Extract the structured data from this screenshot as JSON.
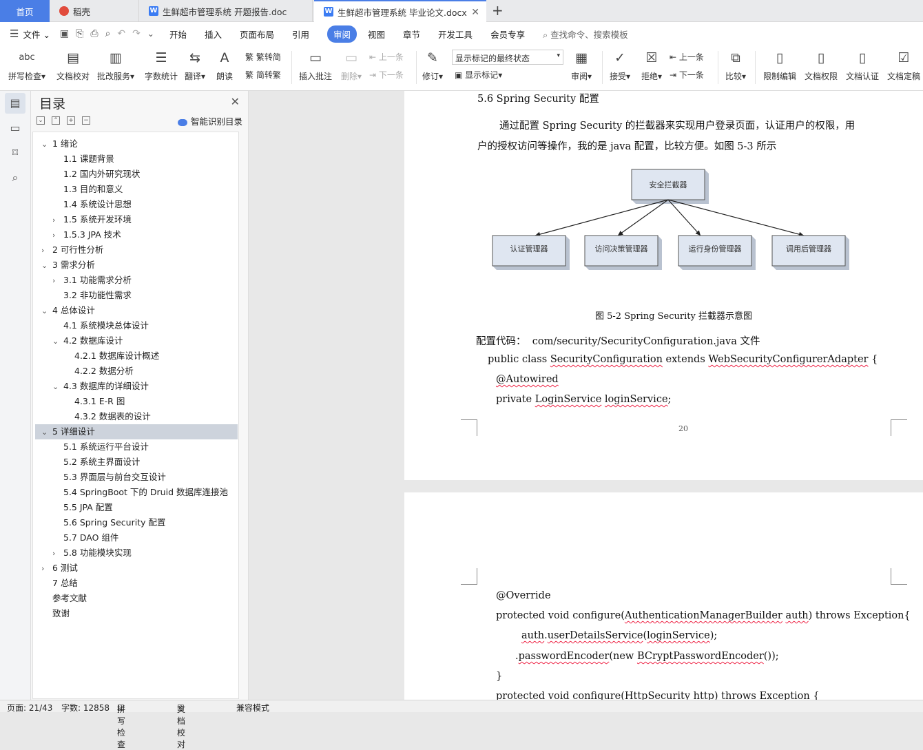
{
  "tabs": {
    "home": "首页",
    "t1": "稻壳",
    "t2": "生鲜超市管理系统 开题报告.doc",
    "t3": "生鲜超市管理系统 毕业论文.docx"
  },
  "menu": {
    "file": "文件",
    "items": [
      "开始",
      "插入",
      "页面布局",
      "引用",
      "审阅",
      "视图",
      "章节",
      "开发工具",
      "会员专享"
    ],
    "search": "查找命令、搜索模板"
  },
  "toolbar": {
    "spell": "拼写检查",
    "proof": "文档校对",
    "batch": "批改服务",
    "wordcount": "字数统计",
    "translate": "翻译",
    "read": "朗读",
    "t2s": "繁转简",
    "s2t": "简转繁",
    "insert_comment": "插入批注",
    "delete": "删除",
    "prev_comment": "上一条",
    "next_comment": "下一条",
    "revise": "修订",
    "dropdown": "显示标记的最终状态",
    "show_marks": "显示标记",
    "review": "审阅",
    "accept": "接受",
    "reject": "拒绝",
    "prev": "上一条",
    "next": "下一条",
    "compare": "比较",
    "restrict": "限制编辑",
    "perm": "文档权限",
    "cert": "文档认证",
    "final": "文档定稿"
  },
  "toc": {
    "title": "目录",
    "smart": "智能识别目录",
    "items": [
      {
        "text": "1 绪论",
        "level": 0,
        "arrow": "v"
      },
      {
        "text": "1.1 课题背景",
        "level": 1,
        "arrow": ""
      },
      {
        "text": "1.2  国内外研究现状",
        "level": 1,
        "arrow": ""
      },
      {
        "text": "1.3  目的和意义",
        "level": 1,
        "arrow": ""
      },
      {
        "text": "1.4  系统设计思想",
        "level": 1,
        "arrow": ""
      },
      {
        "text": "1.5  系统开发环境",
        "level": 1,
        "arrow": ">"
      },
      {
        "text": "1.5.3    JPA 技术",
        "level": 1,
        "arrow": ">"
      },
      {
        "text": "2 可行性分析",
        "level": 0,
        "arrow": ">"
      },
      {
        "text": "3 需求分析",
        "level": 0,
        "arrow": "v"
      },
      {
        "text": "3.1  功能需求分析",
        "level": 1,
        "arrow": ">"
      },
      {
        "text": "3.2  非功能性需求",
        "level": 1,
        "arrow": ""
      },
      {
        "text": "4 总体设计",
        "level": 0,
        "arrow": "v"
      },
      {
        "text": "4.1  系统模块总体设计",
        "level": 1,
        "arrow": ""
      },
      {
        "text": "4.2  数据库设计",
        "level": 1,
        "arrow": "v"
      },
      {
        "text": "4.2.1  数据库设计概述",
        "level": 2,
        "arrow": ""
      },
      {
        "text": "4.2.2  数据分析",
        "level": 2,
        "arrow": ""
      },
      {
        "text": "4.3 数据库的详细设计",
        "level": 1,
        "arrow": "v"
      },
      {
        "text": "4.3.1 E-R 图",
        "level": 2,
        "arrow": ""
      },
      {
        "text": "4.3.2  数据表的设计",
        "level": 2,
        "arrow": ""
      },
      {
        "text": "5 详细设计",
        "level": 0,
        "arrow": "v",
        "selected": true
      },
      {
        "text": "5.1  系统运行平台设计",
        "level": 1,
        "arrow": ""
      },
      {
        "text": "5.2  系统主界面设计",
        "level": 1,
        "arrow": ""
      },
      {
        "text": "5.3  界面层与前台交互设计",
        "level": 1,
        "arrow": ""
      },
      {
        "text": "5.4 SpringBoot 下的 Druid 数据库连接池",
        "level": 1,
        "arrow": ""
      },
      {
        "text": "5.5 JPA 配置",
        "level": 1,
        "arrow": ""
      },
      {
        "text": "5.6 Spring Security 配置",
        "level": 1,
        "arrow": ""
      },
      {
        "text": "5.7 DAO 组件",
        "level": 1,
        "arrow": ""
      },
      {
        "text": "5.8  功能模块实现",
        "level": 1,
        "arrow": ">"
      },
      {
        "text": "6 测试",
        "level": 0,
        "arrow": ">"
      },
      {
        "text": "7 总结",
        "level": 0,
        "arrow": ""
      },
      {
        "text": "参考文献",
        "level": 0,
        "arrow": ""
      },
      {
        "text": "致谢",
        "level": 0,
        "arrow": ""
      }
    ]
  },
  "doc": {
    "heading": "5.6 Spring Security 配置",
    "para1": "通过配置 Spring Security 的拦截器来实现用户登录页面，认证用户的权限，用",
    "para2": "户的授权访问等操作，我的是 java 配置，比较方便。如图 5-3 所示",
    "diagram": {
      "root": "安全拦截器",
      "children": [
        "认证管理器",
        "访问决策管理器",
        "运行身份管理器",
        "调用后管理器"
      ]
    },
    "caption": "图 5-2      Spring Security 拦截器示意图",
    "config_label": "配置代码：",
    "config_path": "com/security/SecurityConfiguration.java 文件",
    "code1_a": "public class ",
    "code1_b": "SecurityConfiguration",
    "code1_c": " extends ",
    "code1_d": "WebSecurityConfigurerAdapter",
    "code1_e": " {",
    "code2": "@Autowired",
    "code3_a": "private ",
    "code3_b": "LoginService",
    "code3_c": " ",
    "code3_d": "loginService",
    "code3_e": ";",
    "page_number": "20",
    "p2_l1": "@Override",
    "p2_l2_a": "protected void configure(",
    "p2_l2_b": "AuthenticationManagerBuilder",
    "p2_l2_c": " ",
    "p2_l2_d": "auth",
    "p2_l2_e": ") throws  Exception{",
    "p2_l3_a": "auth",
    "p2_l3_b": ".",
    "p2_l3_c": "userDetailsService",
    "p2_l3_d": "(",
    "p2_l3_e": "loginService",
    "p2_l3_f": ");",
    "p2_l4_a": ".",
    "p2_l4_b": "passwordEncoder",
    "p2_l4_c": "(new ",
    "p2_l4_d": "BCryptPasswordEncoder",
    "p2_l4_e": "());",
    "p2_l5": "}",
    "p2_l6": "protected void configure(HttpSecurity http) throws  Exception {"
  },
  "status": {
    "page": "页面: 21/43",
    "words": "字数: 12858",
    "spell": "拼写检查",
    "proof": "文档校对",
    "compat": "兼容模式"
  }
}
